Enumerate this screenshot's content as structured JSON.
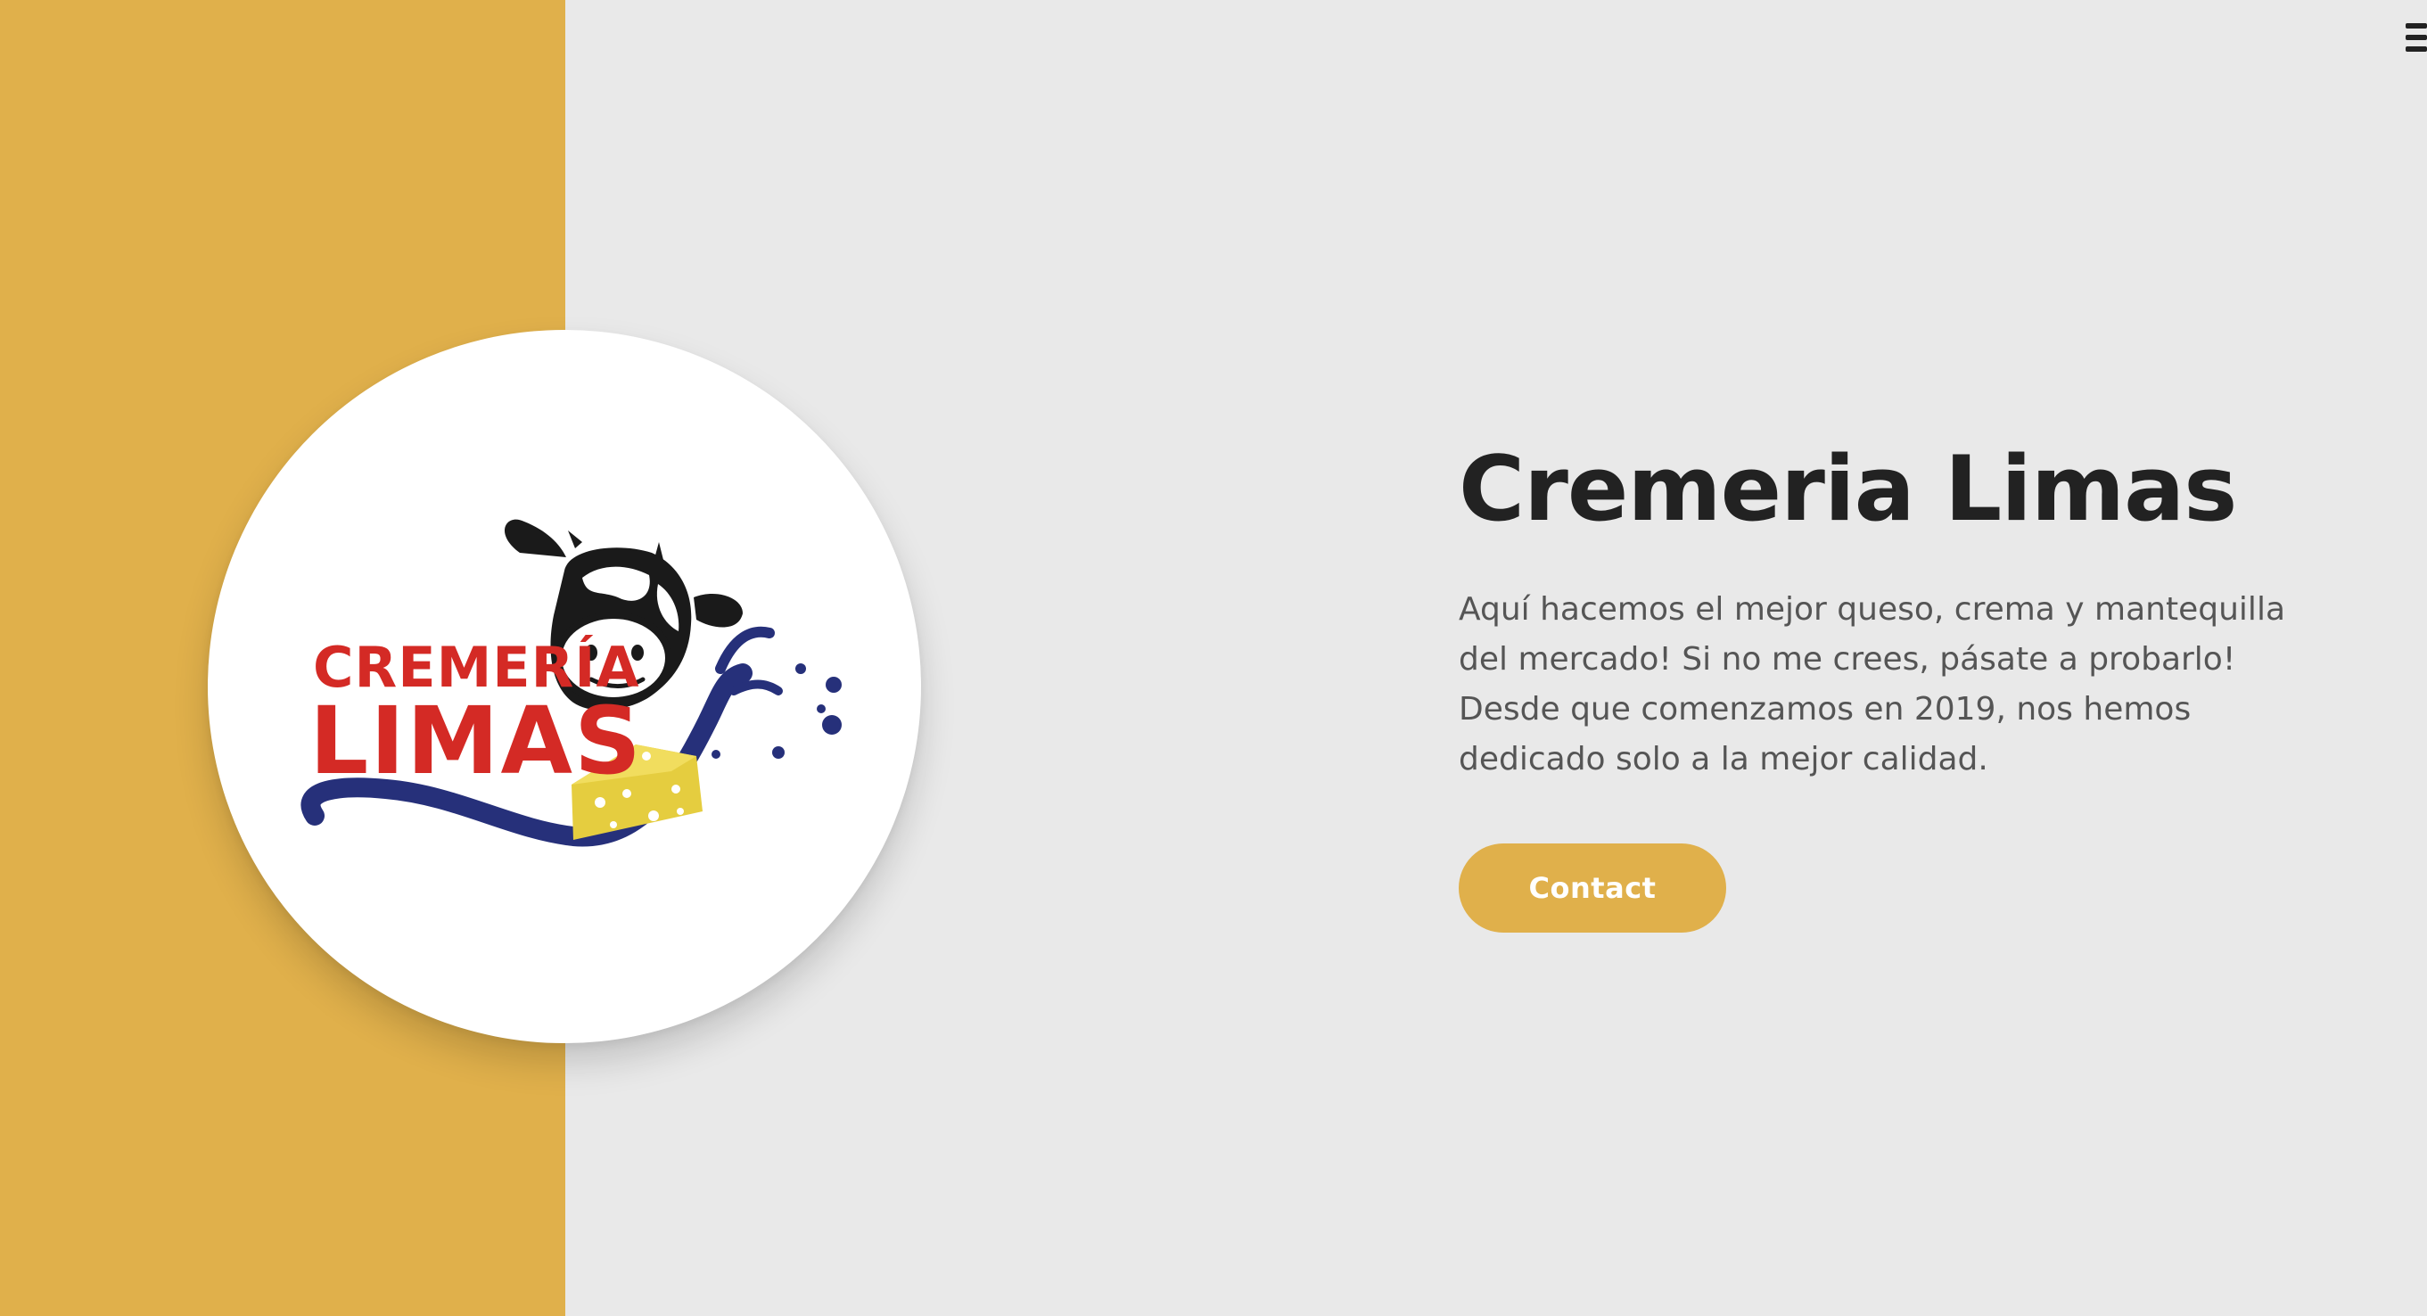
{
  "brand": {
    "logo_text_line1": "CREMERÍA",
    "logo_text_line2": "LIMAS",
    "logo_alt": "cow-cheese-milk-logo"
  },
  "hero": {
    "title": "Cremeria Limas",
    "description": "Aquí hacemos el mejor queso, crema y mantequilla del mercado! Si no me crees, pásate a probarlo! Desde que comenzamos en 2019, nos hemos dedicado solo a la mejor calidad.",
    "cta_label": "Contact"
  },
  "nav": {
    "menu_icon": "hamburger-menu-icon"
  },
  "colors": {
    "accent": "#e0b04b",
    "background": "#e9e9e9",
    "title": "#222222",
    "body_text": "#555555",
    "logo_red": "#d42a25",
    "logo_blue": "#26307a",
    "logo_yellow": "#e5cd3f"
  }
}
